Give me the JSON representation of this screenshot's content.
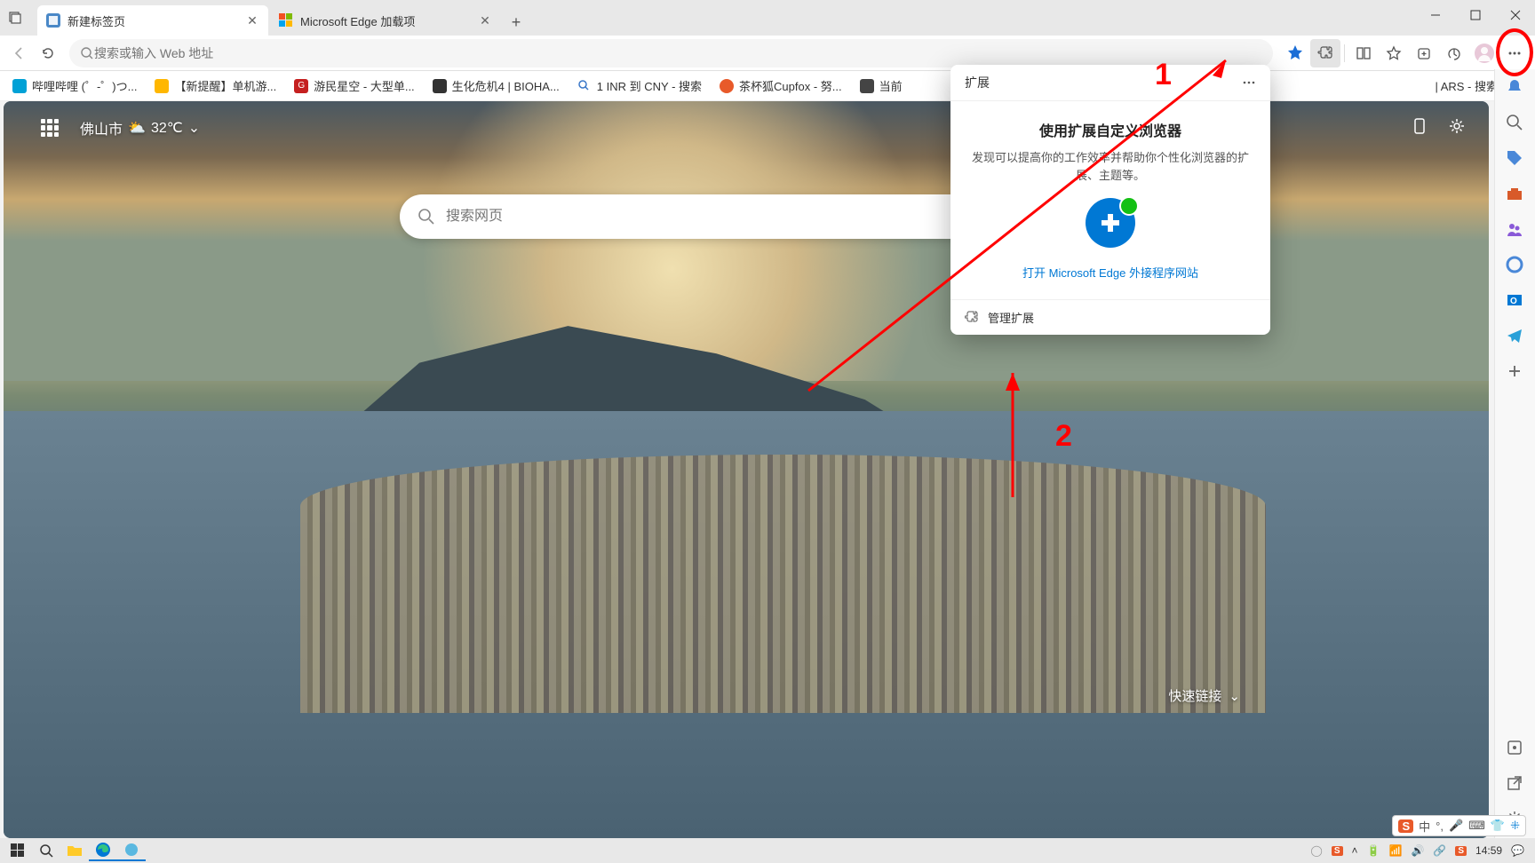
{
  "tabs": [
    {
      "title": "新建标签页",
      "active": true
    },
    {
      "title": "Microsoft Edge 加载项",
      "active": false
    }
  ],
  "addressbar": {
    "placeholder": "搜索或输入 Web 地址"
  },
  "bookmarks": [
    {
      "label": "哔哩哔哩 (゜-゜)つ...",
      "color": "#00a1d6"
    },
    {
      "label": "【新提醒】单机游...",
      "color": "#ffb700"
    },
    {
      "label": "游民星空 - 大型单...",
      "color": "#c52020"
    },
    {
      "label": "生化危机4 | BIOHA...",
      "color": "#333"
    },
    {
      "label": "1 INR 到 CNY - 搜索",
      "color": "#3a77c8"
    },
    {
      "label": "茶杯狐Cupfox - 努...",
      "color": "#e85a2a"
    },
    {
      "label": "当前",
      "color": "#444"
    },
    {
      "label": "| ARS - 搜索",
      "color": "#3a77c8"
    }
  ],
  "ntp": {
    "city": "佛山市",
    "temp": "32℃",
    "search_placeholder": "搜索网页",
    "quicklinks": "快速链接"
  },
  "popup": {
    "header": "扩展",
    "title": "使用扩展自定义浏览器",
    "desc": "发现可以提高你的工作效率并帮助你个性化浏览器的扩展、主题等。",
    "link": "打开 Microsoft Edge 外接程序网站",
    "manage": "管理扩展"
  },
  "annotations": {
    "one": "1",
    "two": "2"
  },
  "ime": {
    "logo": "S",
    "lang": "中",
    "punct": "°,"
  },
  "tray": {
    "time": "14:59"
  }
}
